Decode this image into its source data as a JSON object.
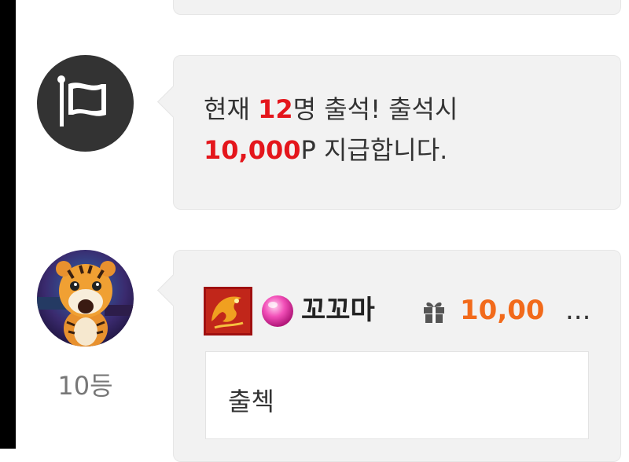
{
  "notice": {
    "prefix": "현재 ",
    "count": "12",
    "after_count": "명 출석! 출석시",
    "points": "10,000",
    "after_points": "P 지급합니다."
  },
  "chat": {
    "rank": "10등",
    "nickname": "꼬꼬마",
    "gift_amount": "10,00",
    "gift_ellipsis": "...",
    "message": "출첵"
  },
  "icons": {
    "notice_avatar": "flag-icon",
    "gift": "gift-icon",
    "level_badge": "dragon-badge",
    "gem": "pink-gem-icon"
  },
  "colors": {
    "highlight_red": "#e4161c",
    "gift_orange": "#f26a1b",
    "bubble_bg": "#f2f2f2",
    "flag_avatar_bg": "#333333"
  }
}
